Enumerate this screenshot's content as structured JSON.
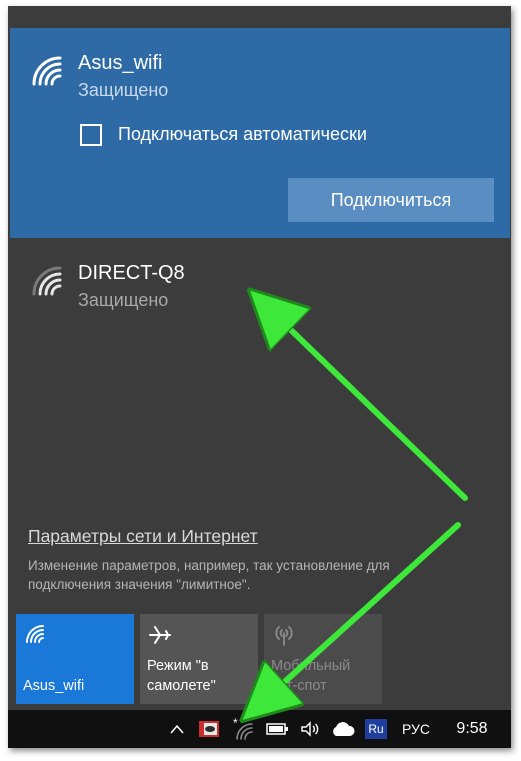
{
  "networks": {
    "selected": {
      "name": "Asus_wifi",
      "status": "Защищено",
      "auto_connect_label": "Подключаться автоматически",
      "auto_connect_checked": false,
      "connect_button": "Подключиться"
    },
    "other": {
      "name": "DIRECT-Q8",
      "status": "Защищено"
    }
  },
  "settings": {
    "link": "Параметры сети и Интернет",
    "description": "Изменение параметров, например, так установление для подключения значения \"лимитное\"."
  },
  "quick_actions": [
    {
      "label": "Asus_wifi",
      "icon": "wifi-icon",
      "active": true
    },
    {
      "label": "Режим \"в самолете\"",
      "icon": "airplane-icon",
      "active": false
    },
    {
      "label": "Мобильный хот-спот",
      "icon": "hotspot-icon",
      "active": false,
      "disabled": true
    }
  ],
  "taskbar": {
    "language_badge": "Ru",
    "language": "РУС",
    "time": "9:58"
  },
  "colors": {
    "panel_bg": "#3c3c3c",
    "selected_bg": "#2d6aa6",
    "tile_active": "#1a78d8",
    "arrow": "#3ee83a"
  }
}
